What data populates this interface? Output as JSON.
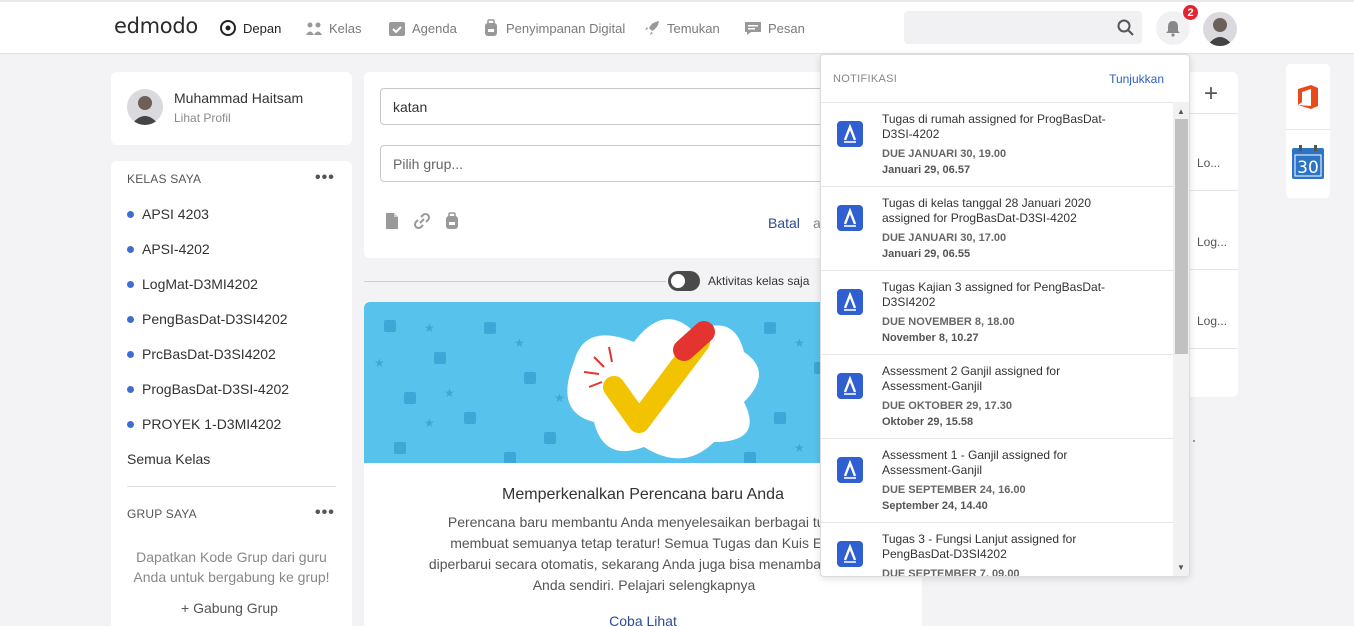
{
  "brand": "edmodo",
  "nav": [
    {
      "label": "Depan",
      "icon": "home-icon",
      "active": true
    },
    {
      "label": "Kelas",
      "icon": "classes-icon"
    },
    {
      "label": "Agenda",
      "icon": "calendar-icon"
    },
    {
      "label": "Penyimpanan Digital",
      "icon": "backpack-icon"
    },
    {
      "label": "Temukan",
      "icon": "rocket-icon"
    },
    {
      "label": "Pesan",
      "icon": "chat-icon"
    }
  ],
  "notification_count": "2",
  "profile": {
    "name": "Muhammad Haitsam",
    "link": "Lihat Profil"
  },
  "my_classes": {
    "title": "KELAS SAYA",
    "items": [
      "APSI 4203",
      "APSI-4202",
      "LogMat-D3MI4202",
      "PengBasDat-D3SI4202",
      "PrcBasDat-D3SI4202",
      "ProgBasDat-D3SI-4202",
      "PROYEK 1-D3MI4202"
    ],
    "all_label": "Semua Kelas"
  },
  "my_groups": {
    "title": "GRUP SAYA",
    "empty_text": "Dapatkan Kode Grup dari guru Anda untuk bergabung ke grup!",
    "join_label": "+ Gabung Grup"
  },
  "compose": {
    "text_value": "katan",
    "group_placeholder": "Pilih grup...",
    "cancel_label": "Batal",
    "cancel_extra": "a"
  },
  "filter": {
    "toggle_label": "Aktivitas kelas saja"
  },
  "promo": {
    "title": "Memperkenalkan Perencana baru Anda",
    "body": "Perencana baru membantu Anda menyelesaikan berbagai tuga membuat semuanya tetap teratur! Semua Tugas dan Kuis Edn diperbarui secara otomatis, sekarang Anda juga bisa menamba tugas Anda sendiri. Pelajari selengkapnya",
    "link": "Coba Lihat"
  },
  "right_panel": {
    "log_labels": [
      "Lo...",
      "Log...",
      "Log..."
    ]
  },
  "notifications": {
    "header": "NOTIFIKASI",
    "show_label": "Tunjukkan",
    "items": [
      {
        "title": "Tugas di rumah assigned for ProgBasDat-D3SI-4202",
        "due": "DUE JANUARI 30, 19.00",
        "time": "Januari 29, 06.57"
      },
      {
        "title": "Tugas di kelas tanggal 28 Januari 2020 assigned for ProgBasDat-D3SI-4202",
        "due": "DUE JANUARI 30, 17.00",
        "time": "Januari 29, 06.55"
      },
      {
        "title": "Tugas Kajian 3 assigned for PengBasDat-D3SI4202",
        "due": "DUE NOVEMBER 8, 18.00",
        "time": "November 8, 10.27"
      },
      {
        "title": "Assessment 2 Ganjil assigned for Assessment-Ganjil",
        "due": "DUE OKTOBER 29, 17.30",
        "time": "Oktober 29, 15.58"
      },
      {
        "title": "Assessment 1 - Ganjil assigned for Assessment-Ganjil",
        "due": "DUE SEPTEMBER 24, 16.00",
        "time": "September 24, 14.40"
      },
      {
        "title": "Tugas 3 - Fungsi Lanjut assigned for PengBasDat-D3SI4202",
        "due": "DUE SEPTEMBER 7, 09.00",
        "time": ""
      }
    ]
  },
  "calendar_day": "30",
  "colors": {
    "accent": "#2c5fc4",
    "badge": "#e0262e",
    "banner": "#57c3ec",
    "class_dot": "#3e6fd0"
  }
}
